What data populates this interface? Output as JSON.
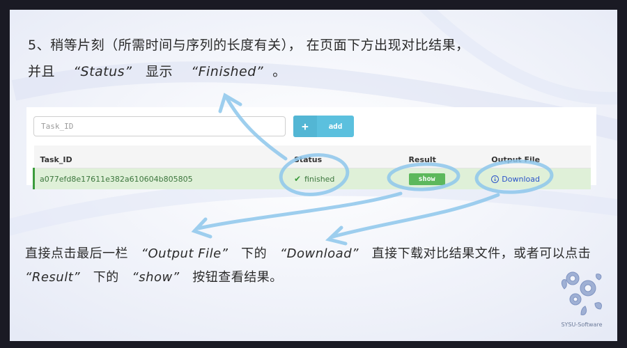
{
  "caption_top": {
    "line1": "5、稍等片刻（所需时间与序列的长度有关）， 在页面下方出现对比结果，",
    "line2_prefix": "并且",
    "line2_status": "“Status”",
    "line2_mid": "显示",
    "line2_finished": "“Finished”",
    "line2_suffix": "。"
  },
  "form": {
    "task_id_placeholder": "Task_ID",
    "add_icon": "+",
    "add_label": "add"
  },
  "table": {
    "columns": [
      "Task_ID",
      "Status",
      "Result",
      "Output File"
    ],
    "rows": [
      {
        "task_id": "a077efd8e17611e382a610604b805805",
        "status": "finished",
        "result_button": "show",
        "output_link": "Download"
      }
    ]
  },
  "caption_bottom": {
    "line1_a": "直接点击最后一栏",
    "line1_output": "“Output File”",
    "line1_b": "下的",
    "line1_download": "“Download”",
    "line1_c": "直接下载对比结果文件，或者可以点击",
    "line2_result": "“Result”",
    "line2_b": "下的",
    "line2_show": "“show”",
    "line2_c": "按钮查看结果。"
  },
  "logo": {
    "text": "SYSU-Software"
  },
  "colors": {
    "annotation": "#8ec7ec",
    "success_bg": "#dff0d8",
    "success_text": "#3c763d",
    "info_button": "#5bc0de",
    "success_button": "#5cb85c",
    "link": "#2a53c9"
  },
  "icons": {
    "check": "check-icon",
    "download": "download-circle-icon",
    "plus": "plus-icon"
  }
}
